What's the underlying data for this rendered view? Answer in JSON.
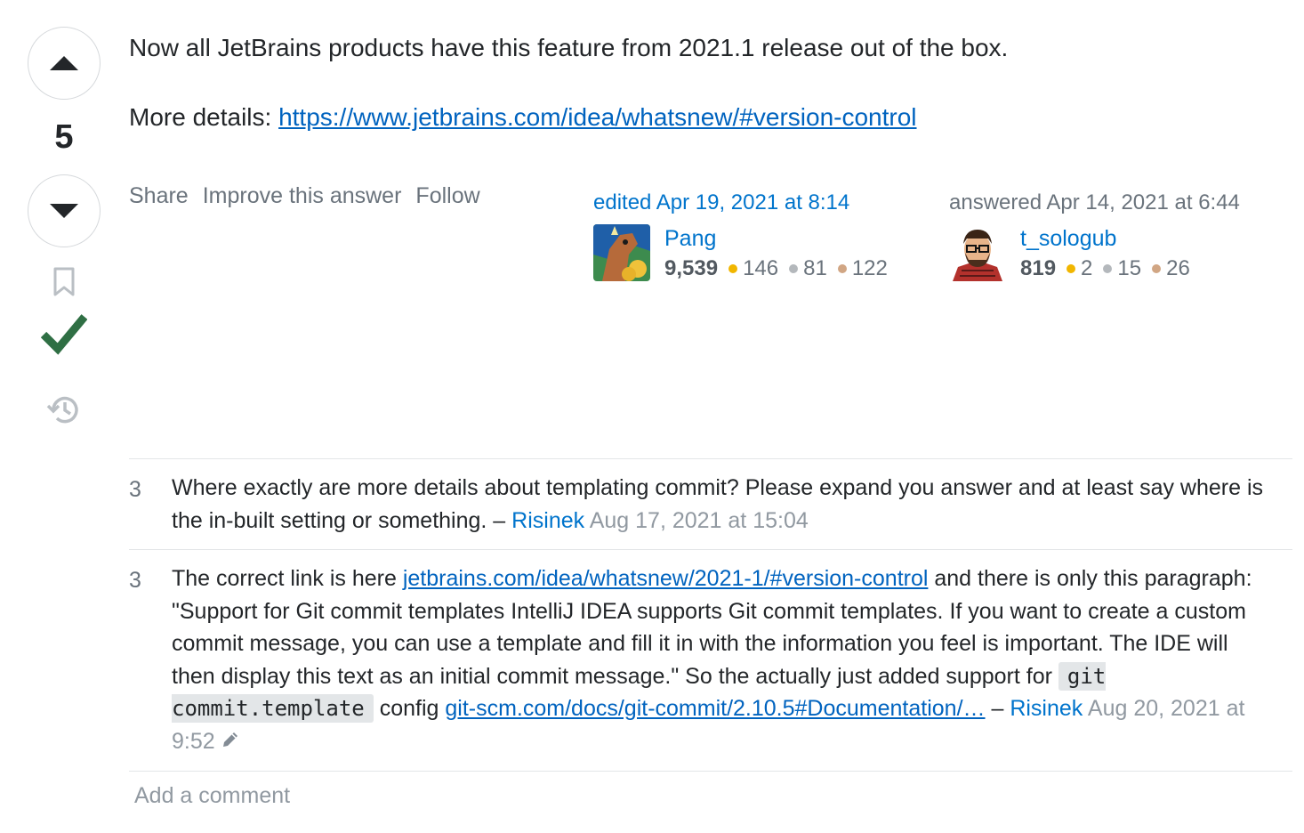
{
  "vote": {
    "count": "5",
    "accepted_color": "#2f6f44"
  },
  "post": {
    "paragraph1": "Now all JetBrains products have this feature from 2021.1 release out of the box.",
    "paragraph2_prefix": "More details: ",
    "paragraph2_link": "https://www.jetbrains.com/idea/whatsnew/#version-control"
  },
  "menu": {
    "share": "Share",
    "improve": "Improve this answer",
    "follow": "Follow"
  },
  "edited": {
    "action": "edited Apr 19, 2021 at 8:14",
    "user": "Pang",
    "rep": "9,539",
    "gold": "146",
    "silver": "81",
    "bronze": "122"
  },
  "answered": {
    "action": "answered Apr 14, 2021 at 6:44",
    "user": "t_sologub",
    "rep": "819",
    "gold": "2",
    "silver": "15",
    "bronze": "26"
  },
  "badge_colors": {
    "gold": "#f1b600",
    "silver": "#9a9c9f",
    "bronze": "#ab825f"
  },
  "comments": [
    {
      "score": "3",
      "text": "Where exactly are more details about templating commit? Please expand you answer and at least say where is the in-built setting or something.",
      "sep": " – ",
      "user": "Risinek",
      "date": "Aug 17, 2021 at 15:04"
    },
    {
      "score": "3",
      "text_a": "The correct link is here ",
      "link1": "jetbrains.com/idea/whatsnew/2021-1/#version-control",
      "text_b": " and there is only this paragraph: \"Support for Git commit templates IntelliJ IDEA supports Git commit templates. If you want to create a custom commit message, you can use a template and fill it in with the information you feel is important. The IDE will then display this text as an initial commit message.\" So the actually just added support for ",
      "code": "git commit.template",
      "text_c": " config ",
      "link2": "git-scm.com/docs/git-commit/2.10.5#Documentation/…",
      "sep": " – ",
      "user": "Risinek",
      "date": "Aug 20, 2021 at 9:52"
    }
  ],
  "add_comment": "Add a comment"
}
